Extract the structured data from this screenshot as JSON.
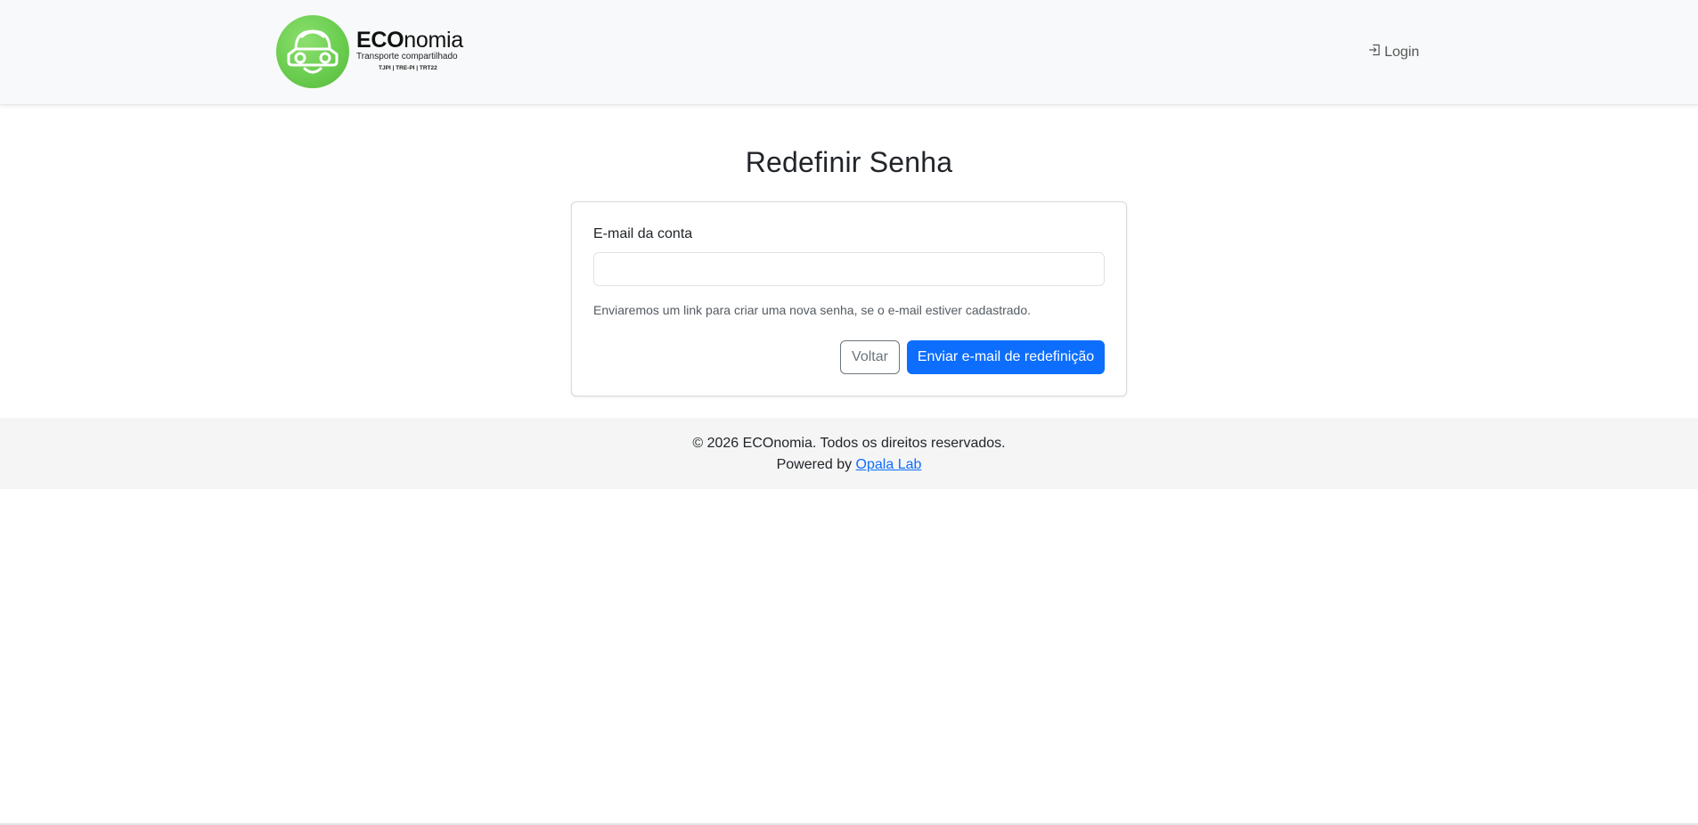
{
  "navbar": {
    "brand": {
      "name_bold": "ECO",
      "name_rest": "nomia",
      "tagline": "Transporte compartilhado",
      "orgs": "TJPI | TRE-PI | TRT22",
      "logo_icon": "car-face-icon",
      "logo_color": "#6acd4f"
    },
    "login": {
      "icon": "login-icon",
      "label": "Login"
    }
  },
  "main": {
    "title": "Redefinir Senha",
    "form": {
      "email_label": "E-mail da conta",
      "email_value": "",
      "email_placeholder": "",
      "help_text": "Enviaremos um link para criar uma nova senha, se o e-mail estiver cadastrado.",
      "back_button": "Voltar",
      "submit_button": "Enviar e-mail de redefinição"
    }
  },
  "footer": {
    "copyright": "© 2026 ECOnomia. Todos os direitos reservados.",
    "powered_prefix": "Powered by ",
    "powered_link": "Opala Lab"
  },
  "colors": {
    "primary": "#0d6efd",
    "secondary": "#6c757d",
    "navbar_bg": "#f8f9fa",
    "footer_bg": "#f5f5f5"
  }
}
